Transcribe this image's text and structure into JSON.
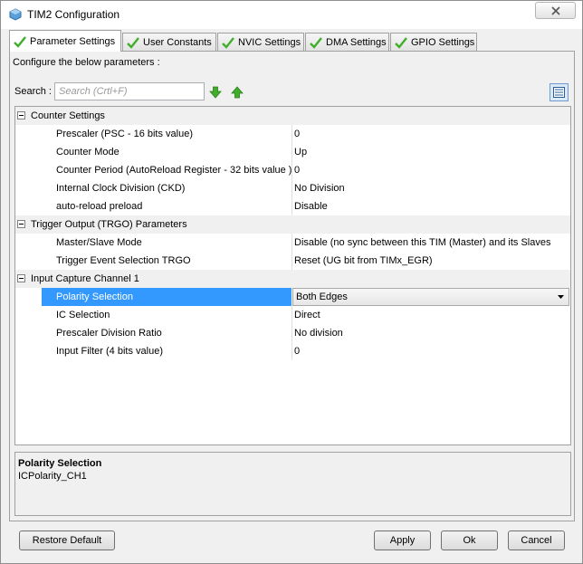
{
  "window": {
    "title": "TIM2 Configuration"
  },
  "tabs": [
    {
      "label": "Parameter Settings",
      "active": true
    },
    {
      "label": "User Constants",
      "active": false
    },
    {
      "label": "NVIC Settings",
      "active": false
    },
    {
      "label": "DMA Settings",
      "active": false
    },
    {
      "label": "GPIO Settings",
      "active": false
    }
  ],
  "panel": {
    "configure_label": "Configure the below parameters :",
    "search": {
      "label": "Search :",
      "placeholder": "Search (Crtl+F)"
    }
  },
  "groups": [
    {
      "title": "Counter Settings",
      "params": [
        {
          "name": "Prescaler (PSC - 16 bits value)",
          "value": "0"
        },
        {
          "name": "Counter Mode",
          "value": "Up"
        },
        {
          "name": "Counter Period (AutoReload Register - 32 bits value )",
          "value": "0"
        },
        {
          "name": "Internal Clock Division (CKD)",
          "value": "No Division"
        },
        {
          "name": "auto-reload preload",
          "value": "Disable"
        }
      ]
    },
    {
      "title": "Trigger Output (TRGO) Parameters",
      "params": [
        {
          "name": "Master/Slave Mode",
          "value": "Disable (no sync between this TIM (Master) and its Slaves"
        },
        {
          "name": "Trigger Event Selection TRGO",
          "value": "Reset (UG bit from TIMx_EGR)"
        }
      ]
    },
    {
      "title": "Input Capture Channel 1",
      "params": [
        {
          "name": "Polarity Selection",
          "value": "Both Edges"
        },
        {
          "name": "IC Selection",
          "value": "Direct"
        },
        {
          "name": "Prescaler Division Ratio",
          "value": "No division"
        },
        {
          "name": "Input Filter (4 bits value)",
          "value": "0"
        }
      ]
    }
  ],
  "description": {
    "title": "Polarity Selection",
    "text": "ICPolarity_CH1"
  },
  "buttons": {
    "restore_default": "Restore Default",
    "apply": "Apply",
    "ok": "Ok",
    "cancel": "Cancel"
  },
  "colors": {
    "selection": "#3399ff",
    "check_green": "#3fae2a",
    "window_bg": "#f0f0f0"
  },
  "icons": {
    "app": "chip-icon",
    "close": "close-icon",
    "tab_check": "check-icon",
    "search_next": "arrow-down-icon",
    "search_prev": "arrow-up-icon",
    "view_toggle": "list-view-icon",
    "group_toggle": "collapse-icon",
    "dropdown": "chevron-down-icon"
  }
}
